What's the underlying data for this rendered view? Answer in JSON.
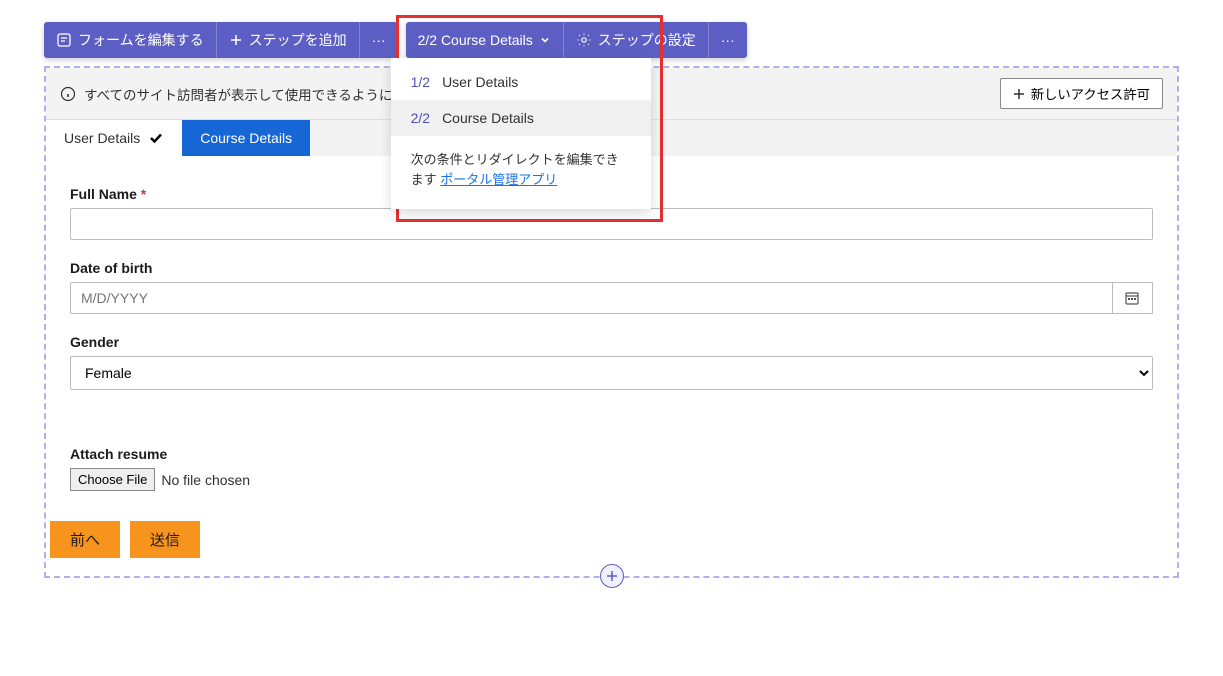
{
  "toolbar1": {
    "edit": "フォームを編集する",
    "add_step": "ステップを追加"
  },
  "toolbar2": {
    "current_step": "2/2 Course Details",
    "settings": "ステップの設定"
  },
  "dropdown": {
    "items": [
      {
        "idx": "1/2",
        "name": "User Details"
      },
      {
        "idx": "2/2",
        "name": "Course Details"
      }
    ],
    "note_prefix": "次の条件とリダイレクトを編集できます ",
    "note_link": "ポータル管理アプリ"
  },
  "infobar": {
    "text": "すべてのサイト訪問者が表示して使用できるように、このフォ",
    "permission_btn": "新しいアクセス許可"
  },
  "tabs": {
    "user_details": "User Details",
    "course_details": "Course Details"
  },
  "form": {
    "full_name_label": "Full Name",
    "dob_label": "Date of birth",
    "dob_placeholder": "M/D/YYYY",
    "gender_label": "Gender",
    "gender_value": "Female",
    "resume_label": "Attach resume",
    "choose_file": "Choose File",
    "no_file": "No file chosen"
  },
  "actions": {
    "prev": "前へ",
    "submit": "送信"
  }
}
